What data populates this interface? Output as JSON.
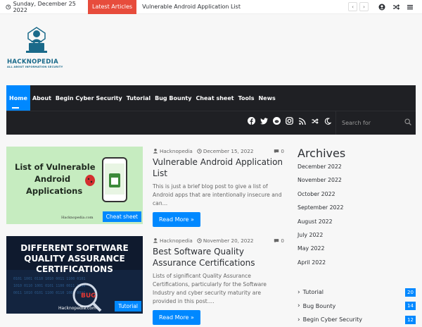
{
  "topbar": {
    "date": "Sunday, December 25 2022",
    "latest_label": "Latest Articles",
    "ticker": "Vulnerable Android Application List",
    "prev_icon": "chevron-left-icon",
    "next_icon": "chevron-right-icon"
  },
  "logo": {
    "name": "HACKNOPEDIA",
    "tagline": "ALL ABOUT INFORMATION SECURITY"
  },
  "nav": {
    "items": [
      "Home",
      "About",
      "Begin Cyber Security",
      "Tutorial",
      "Bug Bounty",
      "Cheat sheet",
      "Tools",
      "News"
    ],
    "active": "Home",
    "search_placeholder": "Search for"
  },
  "posts": [
    {
      "thumb_title_lines": [
        "List of Vulnerable",
        "Android",
        "Applications"
      ],
      "thumb_footer": "Hacknopedia.com",
      "category": "Cheat sheet",
      "author": "Hacknopedia",
      "date": "December 15, 2022",
      "comments": "0",
      "title": "Vulnerable Android Application List",
      "excerpt": "This is just a brief blog post to give a list of Android apps that are intentionally insecure and can…",
      "read_more": "Read More »"
    },
    {
      "thumb_title_lines": [
        "DIFFERENT SOFTWARE",
        "QUALITY ASSURANCE",
        "CERTIFICATIONS"
      ],
      "thumb_footer": "Hacknopedia.com",
      "thumb_bug": "BUG",
      "category": "Tutorial",
      "author": "Hacknopedia",
      "date": "November 20, 2022",
      "comments": "0",
      "title": "Best Software Quality Assurance Certifications",
      "excerpt": "Lists of significant Quality Assurance Certifications, particularly for the Software Industry and cyber security maturity are provided in this post.…",
      "read_more": "Read More »"
    }
  ],
  "sidebar": {
    "archives_title": "Archives",
    "archives": [
      "December 2022",
      "November 2022",
      "October 2022",
      "September 2022",
      "August 2022",
      "July 2022",
      "May 2022",
      "April 2022"
    ],
    "categories": [
      {
        "name": "Tutorial",
        "count": "20"
      },
      {
        "name": "Bug Bounty",
        "count": "14"
      },
      {
        "name": "Begin Cyber Security",
        "count": "12"
      }
    ]
  },
  "colors": {
    "accent": "#0088ff",
    "latest": "#e74c3c",
    "nav_bg": "#1f2024",
    "logo": "#1a6a8a"
  }
}
